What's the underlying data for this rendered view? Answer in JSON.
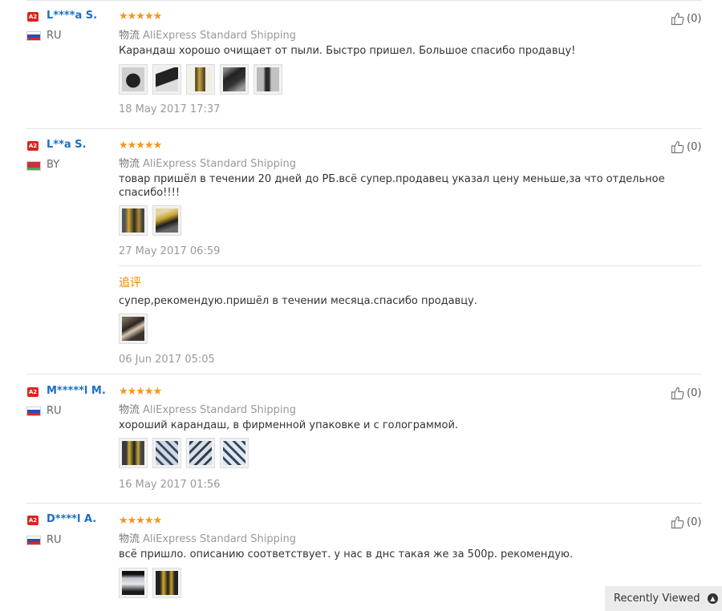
{
  "reviews": [
    {
      "badge": "A2",
      "user": "L****a S.",
      "country": "RU",
      "stars": "★★★★★",
      "logistics_label": "物流",
      "shipping": "AliExpress Standard Shipping",
      "text": "Карандаш хорошо очищает от пыли. Быстро пришел. Большое спасибо продавцу!",
      "photos": [
        "photo-1",
        "photo-2",
        "photo-3",
        "photo-4",
        "photo-5"
      ],
      "date": "18 May 2017 17:37",
      "helpful": "(0)"
    },
    {
      "badge": "A2",
      "user": "L**a S.",
      "country": "BY",
      "stars": "★★★★★",
      "logistics_label": "物流",
      "shipping": "AliExpress Standard Shipping",
      "text": "товар пришёл в течении 20 дней до РБ.всё супер.продавец указал цену меньше,за что отдельное\nспасибо!!!!",
      "photos": [
        "photo-1",
        "photo-2"
      ],
      "date": "27 May 2017 06:59",
      "followup": {
        "label": "追评",
        "text": "супер,рекомендую.пришёл в течении месяца.спасибо продавцу.",
        "photos": [
          "photo-1"
        ],
        "date": "06 Jun 2017 05:05"
      },
      "helpful": "(0)"
    },
    {
      "badge": "A2",
      "user": "M*****l M.",
      "country": "RU",
      "stars": "★★★★★",
      "logistics_label": "物流",
      "shipping": "AliExpress Standard Shipping",
      "text": "хороший карандаш, в фирменной упаковке и с голограммой.",
      "photos": [
        "photo-1",
        "photo-2",
        "photo-3",
        "photo-4"
      ],
      "date": "16 May 2017 01:56",
      "helpful": "(0)"
    },
    {
      "badge": "A2",
      "user": "D****l A.",
      "country": "RU",
      "stars": "★★★★★",
      "logistics_label": "物流",
      "shipping": "AliExpress Standard Shipping",
      "text": "всё пришло. описанию соответствует. у нас в днс такая же за 500р. рекомендую.",
      "photos": [
        "photo-1",
        "photo-2"
      ],
      "helpful": "(0)"
    }
  ],
  "recently_viewed": {
    "label": "Recently Viewed",
    "icon": "chevron-up-icon"
  },
  "colors": {
    "username": "#1a6fc4",
    "stars": "#f7941d",
    "followup": "#f08200",
    "badge": "#d9261c",
    "meta": "#999999"
  }
}
